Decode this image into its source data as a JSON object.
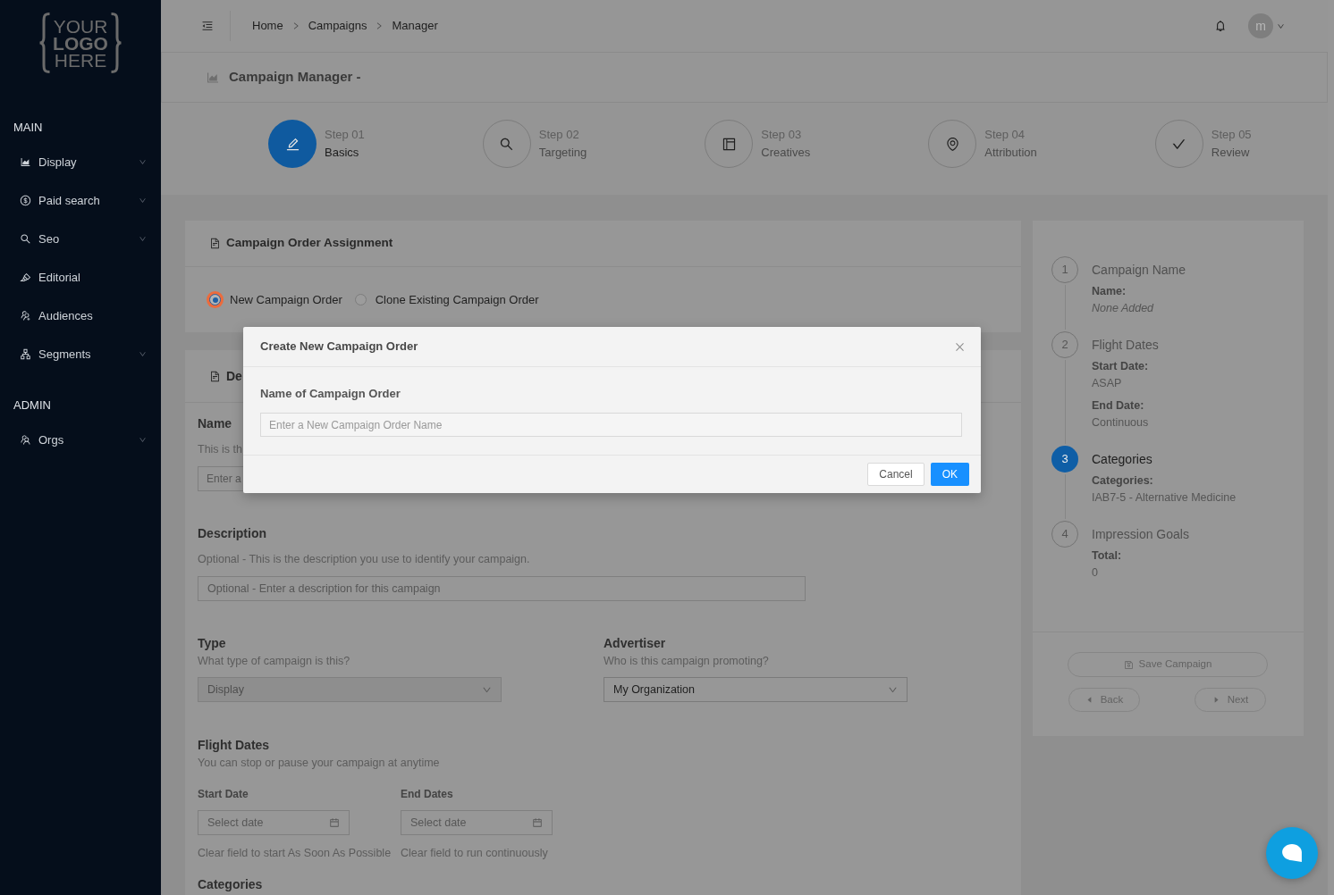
{
  "sidebar": {
    "logo": {
      "lines": [
        "YOUR",
        "LOGO",
        "HERE"
      ]
    },
    "sections": [
      {
        "title": "MAIN",
        "items": [
          {
            "label": "Display",
            "expandable": true
          },
          {
            "label": "Paid search",
            "expandable": true
          },
          {
            "label": "Seo",
            "expandable": true
          },
          {
            "label": "Editorial",
            "expandable": false
          },
          {
            "label": "Audiences",
            "expandable": false
          },
          {
            "label": "Segments",
            "expandable": true
          }
        ]
      },
      {
        "title": "ADMIN",
        "items": [
          {
            "label": "Orgs",
            "expandable": true
          }
        ]
      }
    ]
  },
  "header": {
    "breadcrumb": [
      "Home",
      "Campaigns",
      "Manager"
    ],
    "avatar": {
      "initial": "m"
    }
  },
  "page_title": "Campaign Manager -",
  "steps": [
    {
      "label": "Step 01",
      "title": "Basics",
      "selected": true
    },
    {
      "label": "Step 02",
      "title": "Targeting",
      "selected": false
    },
    {
      "label": "Step 03",
      "title": "Creatives",
      "selected": false
    },
    {
      "label": "Step 04",
      "title": "Attribution",
      "selected": false
    },
    {
      "label": "Step 05",
      "title": "Review",
      "selected": false
    }
  ],
  "assignment": {
    "title": "Campaign Order Assignment",
    "options": [
      {
        "label": "New Campaign Order",
        "selected": true,
        "focused": true
      },
      {
        "label": "Clone Existing Campaign Order",
        "selected": false,
        "focused": false
      }
    ]
  },
  "details": {
    "title": "De",
    "name": {
      "label": "Name",
      "hint": "This is th",
      "placeholder": "Enter a"
    },
    "description": {
      "label": "Description",
      "hint": "Optional - This is the description you use to identify your campaign.",
      "placeholder": "Optional - Enter a description for this campaign"
    },
    "type": {
      "label": "Type",
      "hint": "What type of campaign is this?",
      "value": "Display",
      "disabled": true
    },
    "advertiser": {
      "label": "Advertiser",
      "hint": "Who is this campaign promoting?",
      "value": "My Organization",
      "disabled": false
    },
    "flight_dates": {
      "label": "Flight Dates",
      "hint": "You can stop or pause your campaign at anytime",
      "dates": [
        {
          "label": "Start Date",
          "placeholder": "Select date",
          "note": "Clear field to start As Soon As Possible"
        },
        {
          "label": "End Dates",
          "placeholder": "Select date",
          "note": "Clear field to run continuously"
        }
      ]
    },
    "categories": {
      "label": "Categories"
    }
  },
  "summary": {
    "steps": [
      {
        "number": "1",
        "title": "Campaign Name",
        "selected": false,
        "entries": [
          {
            "label": "Name:",
            "value": "None Added",
            "empty": true
          }
        ]
      },
      {
        "number": "2",
        "title": "Flight Dates",
        "selected": false,
        "entries": [
          {
            "label": "Start Date:",
            "value": "ASAP",
            "empty": false
          },
          {
            "label": "End Date:",
            "value": "Continuous",
            "empty": false
          }
        ]
      },
      {
        "number": "3",
        "title": "Categories",
        "selected": true,
        "entries": [
          {
            "label": "Categories:",
            "value": "IAB7-5 - Alternative Medicine",
            "empty": false
          }
        ]
      },
      {
        "number": "4",
        "title": "Impression Goals",
        "selected": false,
        "entries": [
          {
            "label": "Total:",
            "value": "0",
            "empty": false
          }
        ]
      }
    ],
    "buttons": [
      {
        "label": "Save Campaign",
        "kind": "save",
        "disabled": true
      },
      {
        "label": "Back",
        "kind": "back",
        "disabled": true
      },
      {
        "label": "Next",
        "kind": "next",
        "disabled": true
      }
    ]
  },
  "modal": {
    "title": "Create New Campaign Order",
    "field": {
      "label": "Name of Campaign Order",
      "placeholder": "Enter a New Campaign Order Name"
    },
    "buttons": [
      {
        "label": "Cancel",
        "kind": "default"
      },
      {
        "label": "OK",
        "kind": "primary"
      }
    ]
  }
}
